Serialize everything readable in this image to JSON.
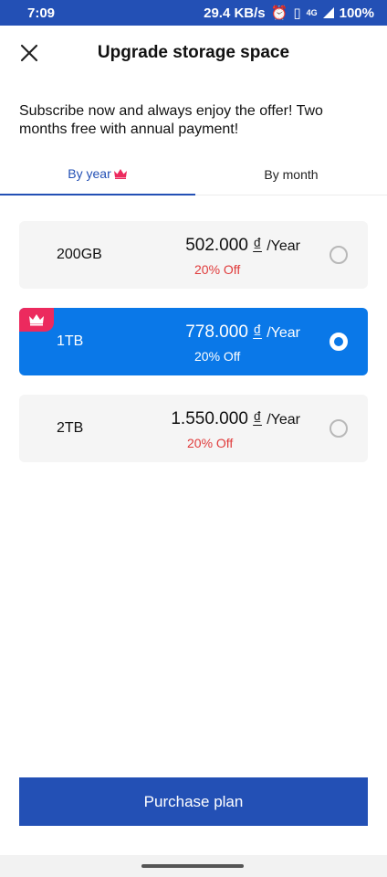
{
  "status_bar": {
    "time": "7:09",
    "net_speed": "29.4 KB/s",
    "network": "4G",
    "battery": "100%"
  },
  "header": {
    "title": "Upgrade storage space",
    "close_icon": "close-icon"
  },
  "subtitle": "Subscribe now and always enjoy the offer! Two months free with annual payment!",
  "tabs": [
    {
      "label": "By year",
      "active": true,
      "icon": "crown-icon"
    },
    {
      "label": "By month",
      "active": false
    }
  ],
  "plans": [
    {
      "size": "200GB",
      "price": "502.000",
      "currency": "₫",
      "period": "/Year",
      "discount": "20% Off",
      "selected": false
    },
    {
      "size": "1TB",
      "price": "778.000",
      "currency": "₫",
      "period": "/Year",
      "discount": "20% Off",
      "selected": true,
      "badge_icon": "crown-icon"
    },
    {
      "size": "2TB",
      "price": "1.550.000",
      "currency": "₫",
      "period": "/Year",
      "discount": "20% Off",
      "selected": false
    }
  ],
  "purchase_button": "Purchase plan",
  "colors": {
    "primary": "#2350b5",
    "selected_plan": "#0a78e8",
    "discount": "#e03b3b",
    "badge": "#ec2a5e"
  }
}
